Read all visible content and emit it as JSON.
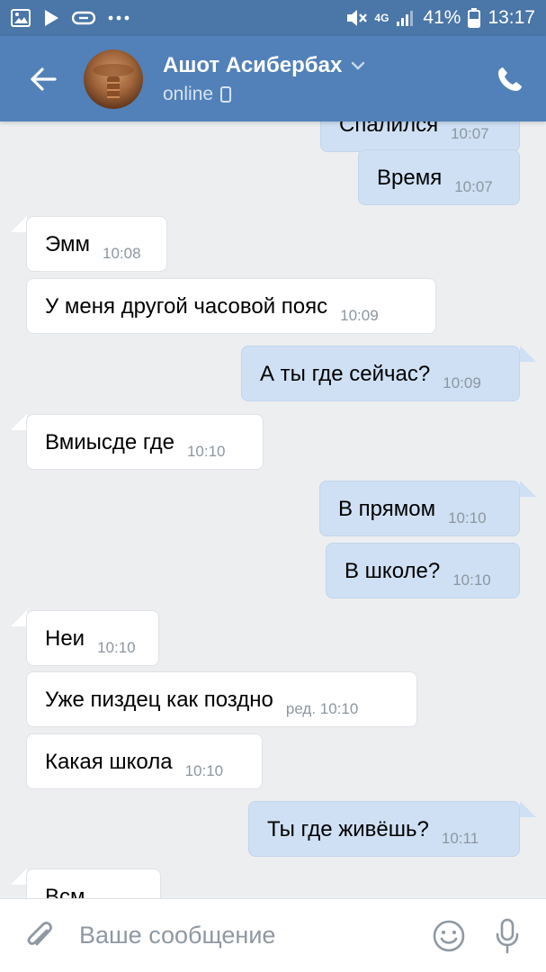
{
  "status_bar": {
    "network": "4G",
    "battery": "41%",
    "time": "13:17",
    "icons": [
      "gallery-icon",
      "play-icon",
      "link-icon",
      "more-dots-icon",
      "mute-icon",
      "signal-icon",
      "battery-icon"
    ]
  },
  "header": {
    "name": "Ашот Асибербах",
    "status": "online"
  },
  "messages": [
    {
      "dir": "out",
      "text": "Спалился",
      "time": "10:07"
    },
    {
      "dir": "out",
      "text": "Время",
      "time": "10:07"
    },
    {
      "dir": "in",
      "text": "Эмм",
      "time": "10:08"
    },
    {
      "dir": "in",
      "text": "У меня другой часовой пояс",
      "time": "10:09"
    },
    {
      "dir": "out",
      "text": "А ты где сейчас?",
      "time": "10:09"
    },
    {
      "dir": "in",
      "text": "Вмиысде где",
      "time": "10:10"
    },
    {
      "dir": "out",
      "text": "В прямом",
      "time": "10:10"
    },
    {
      "dir": "out",
      "text": "В школе?",
      "time": "10:10"
    },
    {
      "dir": "in",
      "text": "Неи",
      "time": "10:10"
    },
    {
      "dir": "in",
      "text": "Уже пиздец как поздно",
      "time": "ред. 10:10"
    },
    {
      "dir": "in",
      "text": "Какая школа",
      "time": "10:10"
    },
    {
      "dir": "out",
      "text": "Ты где живёшь?",
      "time": "10:11"
    },
    {
      "dir": "in",
      "text": "Всм",
      "time": ""
    }
  ],
  "composer": {
    "placeholder": "Ваше сообщение"
  },
  "colors": {
    "header": "#5181b8",
    "statusbar": "#4a76a8",
    "background": "#edeef0",
    "incoming_bubble": "#ffffff",
    "outgoing_bubble": "#cfe0f4"
  }
}
